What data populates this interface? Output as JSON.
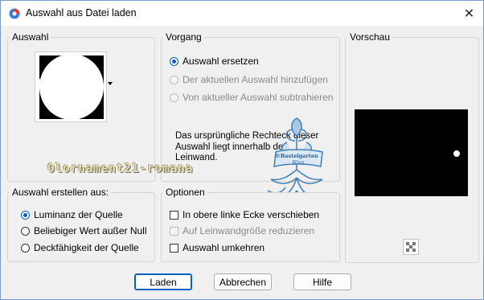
{
  "window": {
    "title": "Auswahl aus Datei laden",
    "close_icon": "close-icon",
    "app_icon": "paintshop-icon"
  },
  "auswahl_group": {
    "legend": "Auswahl"
  },
  "vorgang_group": {
    "legend": "Vorgang",
    "options": [
      {
        "label": "Auswahl ersetzen",
        "selected": true,
        "enabled": true
      },
      {
        "label": "Der aktuellen Auswahl hinzufügen",
        "selected": false,
        "enabled": false
      },
      {
        "label": "Von aktueller Auswahl subtrahieren",
        "selected": false,
        "enabled": false
      }
    ],
    "info_text": "Das ursprüngliche Rechteck dieser Auswahl liegt innerhalb der Leinwand."
  },
  "vorschau_group": {
    "legend": "Vorschau",
    "checker_icon": "transparency-checker-icon"
  },
  "erstellen_group": {
    "legend": "Auswahl erstellen aus:",
    "options": [
      {
        "label": "Luminanz der Quelle",
        "selected": true
      },
      {
        "label": "Beliebiger Wert außer Null",
        "selected": false
      },
      {
        "label": "Deckfähigkeit der Quelle",
        "selected": false
      }
    ]
  },
  "optionen_group": {
    "legend": "Optionen",
    "options": [
      {
        "label": "In obere linke Ecke verschieben",
        "checked": false,
        "enabled": true
      },
      {
        "label": "Auf Leinwandgröße reduzieren",
        "checked": false,
        "enabled": false
      },
      {
        "label": "Auswahl umkehren",
        "checked": false,
        "enabled": true
      }
    ]
  },
  "buttons": {
    "load": "Laden",
    "cancel": "Abbrechen",
    "help": "Hilfe"
  },
  "overlay": {
    "filename_text": "Olornament21-romana",
    "stamp_line1": "©Bastelgarten",
    "stamp_line2": "Wien"
  },
  "colors": {
    "accent": "#0a5fc7",
    "preview_bg": "#000000"
  }
}
